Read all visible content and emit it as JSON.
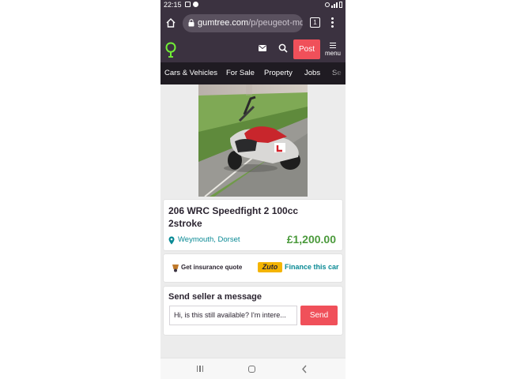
{
  "status_bar": {
    "time": "22:15"
  },
  "browser": {
    "url_host": "gumtree.com",
    "url_path": "/p/peugeot-mo",
    "tab_count": "1"
  },
  "header": {
    "post_label": "Post",
    "menu_label": "menu"
  },
  "categories": [
    "Cars & Vehicles",
    "For Sale",
    "Property",
    "Jobs",
    "Se"
  ],
  "listing": {
    "title": "206 WRC Speedfight 2 100cc 2stroke",
    "location": "Weymouth, Dorset",
    "price": "£1,200.00"
  },
  "insurance": {
    "quote_label": "Get insurance quote",
    "zuto_logo": "Zuto",
    "finance_label": "Finance this car"
  },
  "message": {
    "title": "Send seller a message",
    "input_value": "Hi, is this still available? I'm intere...",
    "send_label": "Send"
  },
  "colors": {
    "header_bg": "#3b3240",
    "catnav_bg": "#1f1b22",
    "accent_red": "#f0505a",
    "price_green": "#4b9a3c",
    "link_teal": "#0a8a95",
    "brand_green": "#72ef36"
  },
  "icons": [
    "home-icon",
    "lock-icon",
    "tabs-icon",
    "more-vert-icon",
    "gumtree-logo",
    "mail-icon",
    "search-icon",
    "map-pin-icon",
    "insurance-icon",
    "recents-icon",
    "home-nav-icon",
    "back-icon"
  ]
}
